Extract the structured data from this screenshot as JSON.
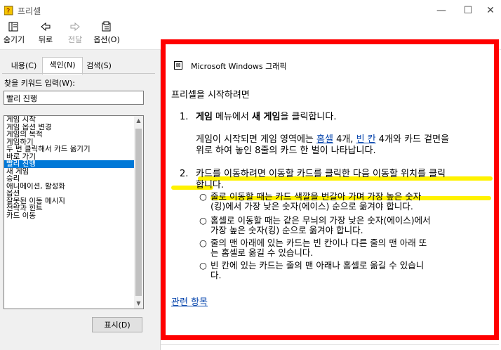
{
  "window": {
    "title": "프리셀"
  },
  "toolbar": {
    "hide_label": "숨기기",
    "back_label": "뒤로",
    "forward_label": "전달",
    "options_label": "옵션(O)"
  },
  "tabs": {
    "contents": "내용(C)",
    "index": "색인(N)",
    "search": "검색(S)"
  },
  "index_panel": {
    "keyword_label": "찾을 키워드 입력(W):",
    "keyword_value": "빨리 진행",
    "items": [
      "게임 시작",
      "게임 옵션 변경",
      "게임의 목적",
      "게임하기",
      "두 번 클릭해서 카드 옮기기",
      "바로 가기",
      "빨리 진행",
      "새 게임",
      "승리",
      "애니메이션, 활성화",
      "옵션",
      "잘못된 이동 메시지",
      "전략과 힌트",
      "카드 이동"
    ],
    "selected_index": 6,
    "show_button": "표시(D)"
  },
  "content": {
    "header": "Microsoft Windows 그래픽",
    "intro": "프리셀을 시작하려면",
    "step1": {
      "num": "1.",
      "pre": "",
      "bold1": "게임",
      "mid": " 메뉴에서 ",
      "bold2": "새 게임",
      "post": "을 클릭합니다."
    },
    "step1_para": {
      "a": "게임이 시작되면 게임 영역에는 ",
      "link1": "홈셀",
      "b": " 4개, ",
      "link2": "빈 칸",
      "c": " 4개와 카드 겉면을",
      "line2": "위로 하여 놓인 8줄의 카드 한 벌이 나타납니다."
    },
    "step2": {
      "num": "2.",
      "line1": "카드를 이동하려면 이동할 카드를 클릭한 다음 이동할 위치를 클릭",
      "line2": "합니다."
    },
    "bullets": [
      {
        "l1": "줄로 이동할 때는 카드 색깔을 번갈아 가며 가장 높은 숫자",
        "l2": "(킹)에서 가장 낮은 숫자(에이스) 순으로 옮겨야 합니다."
      },
      {
        "l1": "홈셀로 이동할 때는 같은 무늬의 가장 낮은 숫자(에이스)에서",
        "l2": "가장 높은 숫자(킹) 순으로 옮겨야 합니다."
      },
      {
        "l1": "줄의 맨 아래에 있는 카드는 빈 칸이나 다른 줄의 맨 아래 또",
        "l2": "는 홈셀로 옮길 수 있습니다."
      },
      {
        "l1": "빈 칸에 있는 카드는 줄의 맨 아래나 홈셀로 옮길 수 있습니",
        "l2": "다."
      }
    ],
    "related": "관련 항목"
  },
  "colors": {
    "frame": "#ff0000",
    "highlight": "#fff200",
    "selection": "#0078d7",
    "link": "#0645ad"
  }
}
